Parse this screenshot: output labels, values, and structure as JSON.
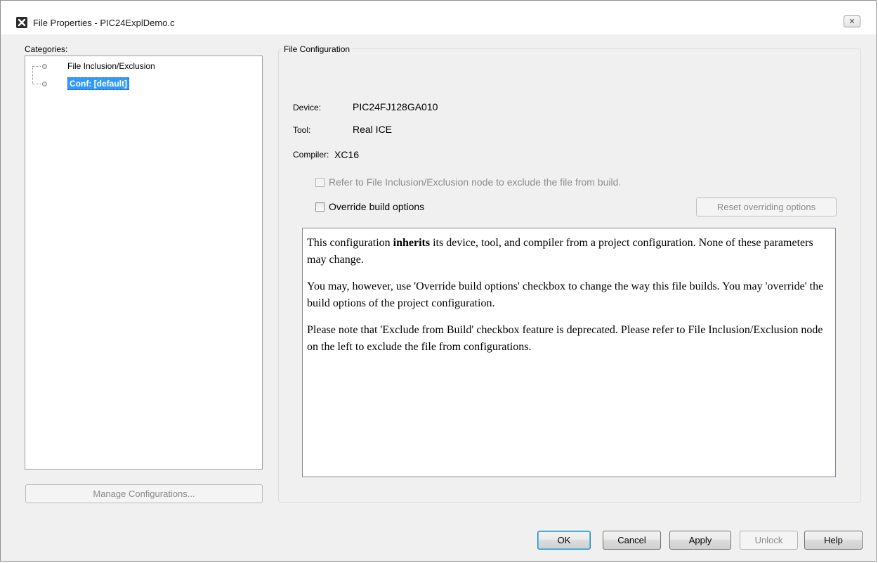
{
  "window": {
    "title": "File Properties - PIC24ExplDemo.c",
    "close_label": "✕"
  },
  "categories": {
    "label": "Categories:",
    "items": [
      {
        "label": "File Inclusion/Exclusion"
      },
      {
        "label": "Conf: [default]"
      }
    ],
    "manage_button": "Manage Configurations..."
  },
  "config": {
    "legend": "File Configuration",
    "device_label": "Device:",
    "device_value": "PIC24FJ128GA010",
    "tool_label": "Tool:",
    "tool_value": "Real ICE",
    "compiler_label": "Compiler:",
    "compiler_value": "XC16",
    "refer_checkbox": "Refer to File Inclusion/Exclusion node to exclude the file from build.",
    "override_checkbox": "Override build options",
    "reset_button": "Reset overriding options",
    "description": {
      "p1_pre": "This configuration ",
      "p1_bold": "inherits",
      "p1_post": " its device, tool, and compiler from a project configuration. None of these parameters may change.",
      "p2": "You may, however, use 'Override build options' checkbox to change the way this file builds. You may 'override' the build options of the project configuration.",
      "p3": "Please note that 'Exclude from Build' checkbox feature is deprecated. Please refer to File Inclusion/Exclusion node on the left to exclude the file from configurations."
    }
  },
  "buttons": {
    "ok": "OK",
    "cancel": "Cancel",
    "apply": "Apply",
    "unlock": "Unlock",
    "help": "Help"
  }
}
